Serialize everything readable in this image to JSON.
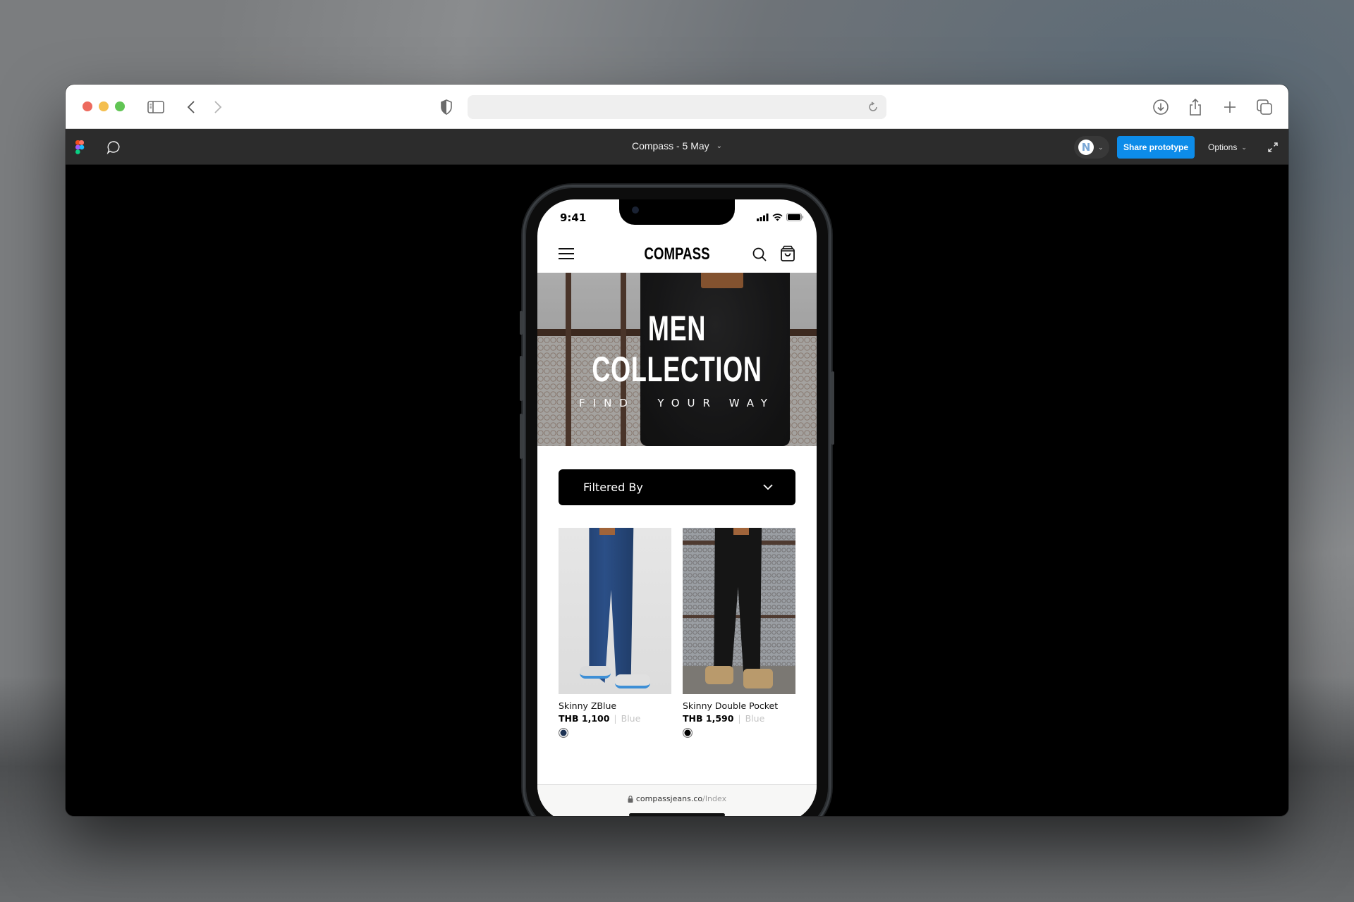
{
  "browser": {
    "nav_back": "back",
    "nav_forward": "forward",
    "url_value": ""
  },
  "figma": {
    "file_title": "Compass - 5 May",
    "avatar_initial": "N",
    "share_label": "Share prototype",
    "options_label": "Options"
  },
  "phone": {
    "status_time": "9:41",
    "app": {
      "brand": "COMPASS",
      "hero": {
        "title_line1": "MEN",
        "title_line2": "COLLECTION",
        "subtitle": "FIND  YOUR WAY"
      },
      "filter": {
        "label": "Filtered By"
      },
      "products": [
        {
          "name": "Skinny ZBlue",
          "price": "THB 1,100",
          "separator": "|",
          "color_name": "Blue",
          "swatch": "#1e3354"
        },
        {
          "name": "Skinny Double Pocket",
          "price": "THB 1,590",
          "separator": "|",
          "color_name": "Blue",
          "swatch": "#000000"
        }
      ]
    },
    "address_bar": {
      "domain": "compassjeans.co",
      "path": "/Index"
    }
  },
  "colors": {
    "share_button": "#0d8ce9",
    "figma_bar": "#2c2c2c",
    "filter_bg": "#000000"
  }
}
